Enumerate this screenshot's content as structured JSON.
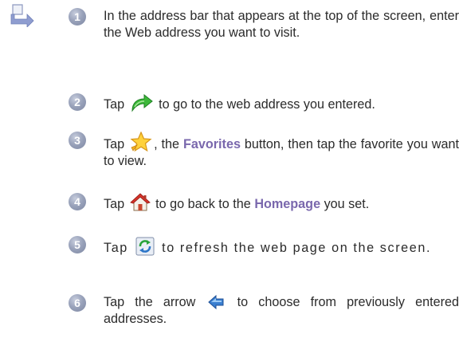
{
  "icons": {
    "side": "page-turn-arrow-icon",
    "go": "go-arrow-icon",
    "favorites": "favorites-star-icon",
    "home": "home-icon",
    "refresh": "refresh-icon",
    "history": "history-arrow-icon"
  },
  "colors": {
    "highlight": "#7a68ad",
    "badge": "#8d96b0",
    "text": "#2b2b2b"
  },
  "steps": [
    {
      "num": "1",
      "text": "In the address bar that appears at the top of the screen, enter the Web address you want to visit."
    },
    {
      "num": "2",
      "before": "Tap",
      "after": "to go to the web address you entered."
    },
    {
      "num": "3",
      "before": "Tap",
      "mid": ", the",
      "highlight": "Favorites",
      "after": "button, then tap the favorite you want to view."
    },
    {
      "num": "4",
      "before": "Tap",
      "mid": "to go back to the",
      "highlight": "Homepage",
      "after": "you set."
    },
    {
      "num": "5",
      "before": "Tap",
      "after": "to refresh the web page on the screen."
    },
    {
      "num": "6",
      "before": "Tap the arrow",
      "after": "to choose from previously entered addresses."
    }
  ]
}
